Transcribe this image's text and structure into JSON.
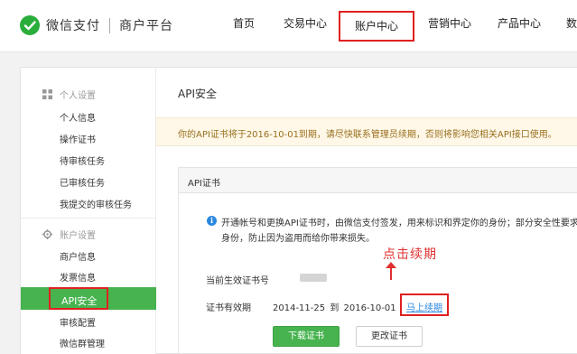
{
  "header": {
    "brand": "微信支付",
    "sub_brand": "商户平台",
    "nav": [
      "首页",
      "交易中心",
      "账户中心",
      "营销中心",
      "产品中心",
      "数"
    ],
    "active_nav": "账户中心"
  },
  "sidebar": {
    "group1_label": "个人设置",
    "group1_items": [
      "个人信息",
      "操作证书",
      "待审核任务",
      "已审核任务",
      "我提交的审核任务"
    ],
    "group2_label": "账户设置",
    "group2_items": [
      "商户信息",
      "发票信息",
      "API安全",
      "审核配置",
      "微信群管理"
    ]
  },
  "main": {
    "title": "API安全",
    "notice": "你的API证书将于2016-10-01到期，请尽快联系管理员续期，否则将影响您相关API接口使用。",
    "cert": {
      "header": "API证书",
      "info_line1": "开通帐号和更换API证书时，由微信支付签发，用来标识和界定你的身份；部分安全性要求较",
      "info_line2": "身份，防止因为盗用而给你带来损失。",
      "serial_label": "当前生效证书号",
      "validity_label": "证书有效期",
      "valid_from": "2014-11-25",
      "to_word": "到",
      "valid_to": "2016-10-01",
      "renew_link": "马上续期",
      "download_button": "下载证书",
      "change_button": "更改证书"
    },
    "annotation": "点击续期"
  },
  "colors": {
    "brand_green": "#47b34f",
    "highlight_red": "#e02020",
    "link_blue": "#2a87e0",
    "notice_text": "#996f1d"
  }
}
